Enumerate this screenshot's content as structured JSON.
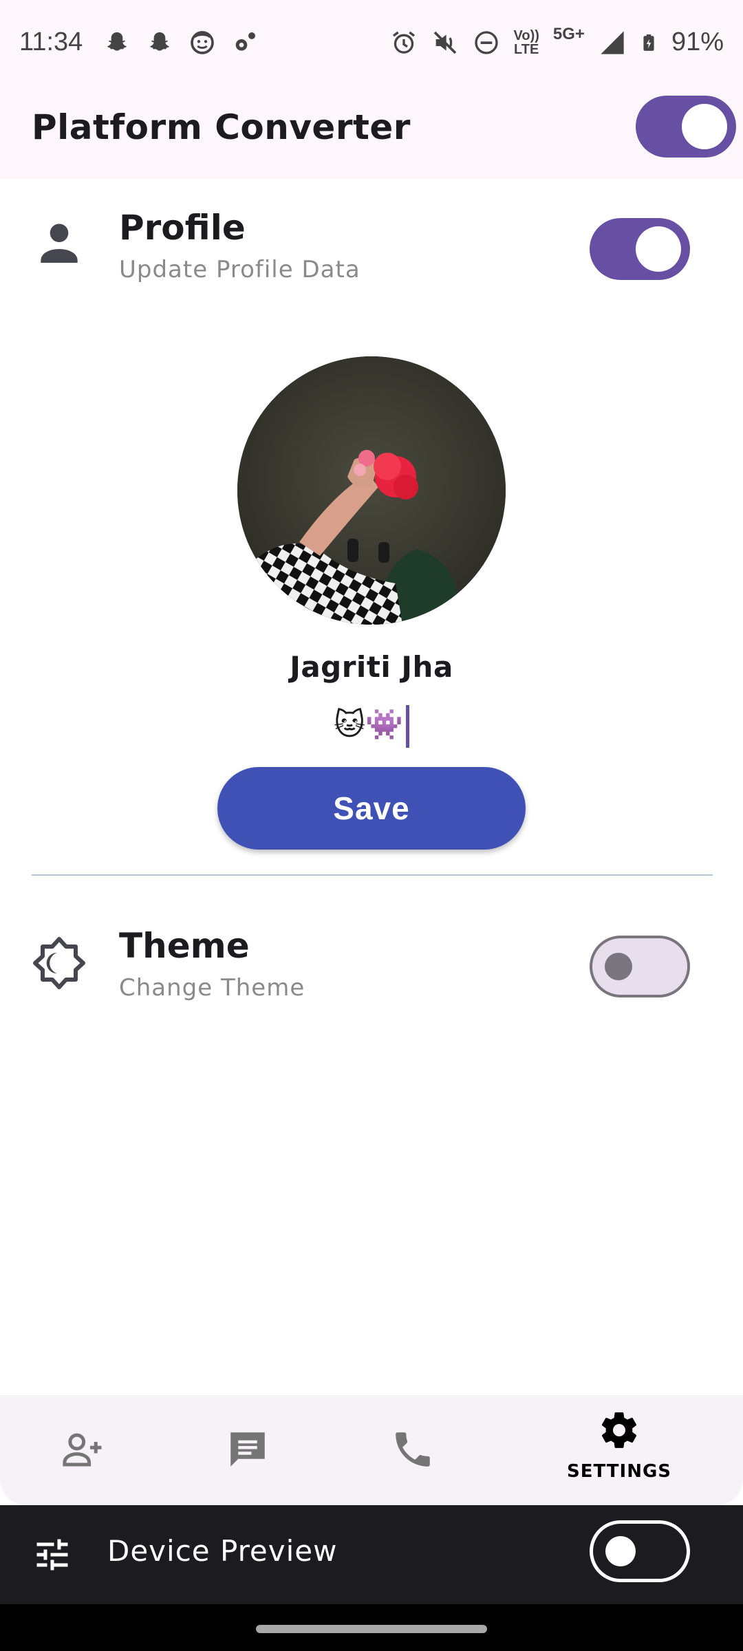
{
  "status_bar": {
    "time": "11:34",
    "battery": "91%",
    "network_top": "Vo))",
    "network_bottom": "LTE",
    "network_5g": "5G+"
  },
  "app_bar": {
    "title": "Platform Converter",
    "toggle_on": true
  },
  "profile_row": {
    "title": "Profile",
    "subtitle": "Update Profile Data",
    "icon": "person-icon",
    "toggle_on": true
  },
  "profile": {
    "name": "Jagriti Jha",
    "bio": "🐱👾",
    "save_label": "Save"
  },
  "theme_row": {
    "title": "Theme",
    "subtitle": "Change Theme",
    "icon": "brightness-icon",
    "toggle_on": false
  },
  "bottom_nav": {
    "items": [
      {
        "icon": "add-person-icon",
        "label": ""
      },
      {
        "icon": "chat-icon",
        "label": ""
      },
      {
        "icon": "phone-icon",
        "label": ""
      },
      {
        "icon": "settings-icon",
        "label": "SETTINGS",
        "selected": true
      }
    ]
  },
  "device_preview": {
    "label": "Device Preview",
    "icon": "tune-icon",
    "toggle_on": false
  },
  "colors": {
    "accent": "#6750a4",
    "save_button": "#3f51b5",
    "app_bar_bg": "#fdf7fc"
  }
}
